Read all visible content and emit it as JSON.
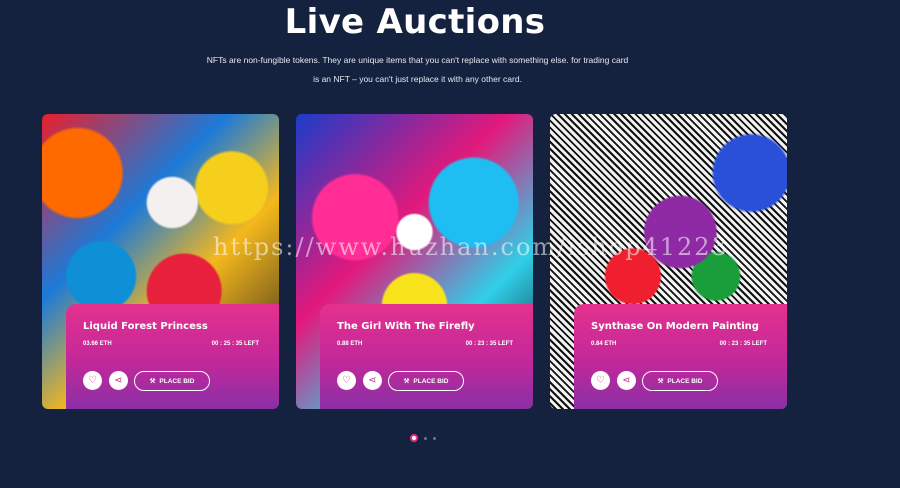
{
  "section": {
    "title": "Live Auctions",
    "subtitle": "NFTs are non-fungible tokens. They are unique items that you can't replace with something else. for trading card is an NFT – you can't just replace it with any other card."
  },
  "cards": [
    {
      "name": "Liquid Forest Princess",
      "price": "03.66 ETH",
      "time_left": "00 : 25 : 35 LEFT",
      "bid_label": "PLACE BID"
    },
    {
      "name": "The Girl With The Firefly",
      "price": "0.88 ETH",
      "time_left": "00 : 23 : 35 LEFT",
      "bid_label": "PLACE BID"
    },
    {
      "name": "Synthase On Modern Painting",
      "price": "0.84 ETH",
      "time_left": "00 : 23 : 35 LEFT",
      "bid_label": "PLACE BID"
    }
  ],
  "watermark": "https://www.huzhan.com/ishop41223",
  "icons": {
    "like": "heart-icon",
    "share": "share-icon",
    "bid": "gavel-icon"
  },
  "colors": {
    "background": "#15223f",
    "accent": "#e4318e",
    "accent_dark": "#8a2fa6"
  }
}
